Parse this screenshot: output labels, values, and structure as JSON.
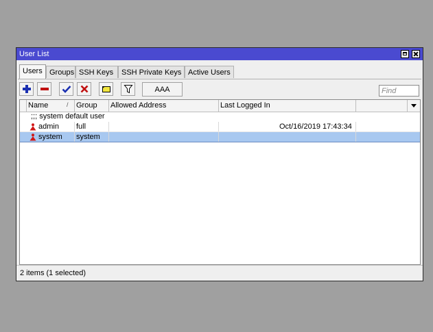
{
  "window": {
    "title": "User List"
  },
  "tabs": [
    {
      "label": "Users",
      "active": true
    },
    {
      "label": "Groups",
      "active": false
    },
    {
      "label": "SSH Keys",
      "active": false
    },
    {
      "label": "SSH Private Keys",
      "active": false
    },
    {
      "label": "Active Users",
      "active": false
    }
  ],
  "toolbar": {
    "buttons": [
      "add-icon",
      "remove-icon",
      "enable-icon",
      "disable-icon",
      "comment-icon",
      "filter-icon"
    ],
    "aaa_label": "AAA",
    "find_placeholder": "Find"
  },
  "table": {
    "columns": [
      "Name",
      "Group",
      "Allowed Address",
      "Last Logged In"
    ],
    "sort_indicator": "/",
    "comment": ";;; system default user",
    "rows": [
      {
        "name": "admin",
        "group": "full",
        "allowed_address": "",
        "last_logged_in": "Oct/16/2019 17:43:34",
        "selected": false
      },
      {
        "name": "system",
        "group": "system",
        "allowed_address": "",
        "last_logged_in": "",
        "selected": true
      }
    ]
  },
  "status": {
    "text": "2 items (1 selected)"
  },
  "colors": {
    "titlebar": "#4a4ad0",
    "selection": "#a8c8f0",
    "user_icon": "#d01818"
  }
}
